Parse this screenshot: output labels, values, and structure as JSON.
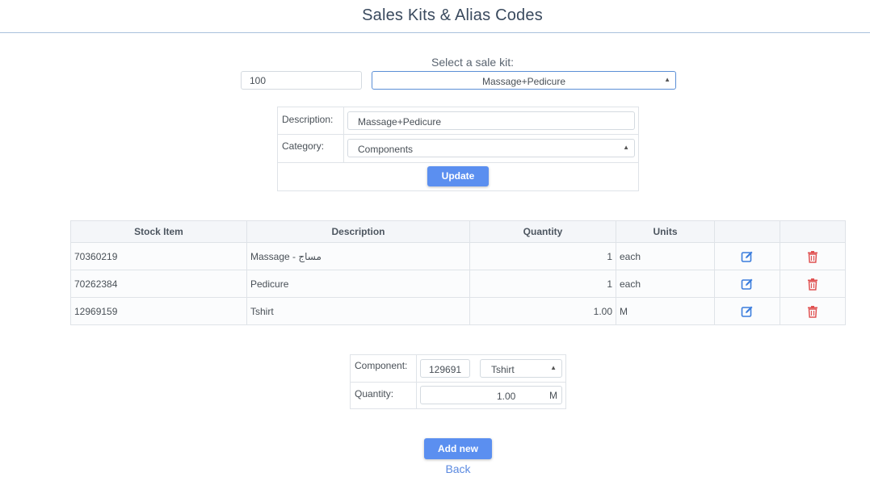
{
  "page": {
    "title": "Sales Kits & Alias Codes"
  },
  "kit_selector": {
    "label": "Select a sale kit:",
    "code_value": "100",
    "selected_kit": "Massage+Pedicure"
  },
  "kit_form": {
    "description_label": "Description:",
    "description_value": "Massage+Pedicure",
    "category_label": "Category:",
    "category_value": "Components",
    "update_label": "Update"
  },
  "components_table": {
    "headers": [
      "Stock Item",
      "Description",
      "Quantity",
      "Units",
      "",
      ""
    ],
    "rows": [
      {
        "stock_item": "70360219",
        "description": "Massage - مساج",
        "quantity": "1",
        "units": "each"
      },
      {
        "stock_item": "70262384",
        "description": "Pedicure",
        "quantity": "1",
        "units": "each"
      },
      {
        "stock_item": "12969159",
        "description": "Tshirt",
        "quantity": "1.00",
        "units": "M"
      }
    ]
  },
  "add_component": {
    "component_label": "Component:",
    "component_code": "129691",
    "component_name": "Tshirt",
    "quantity_label": "Quantity:",
    "quantity_value": "1.00",
    "quantity_unit": "M",
    "add_label": "Add new"
  },
  "nav": {
    "back_label": "Back"
  },
  "colors": {
    "accent": "#5b8ff0",
    "edit_icon": "#3b7ddd",
    "delete_icon": "#e05252",
    "rule": "#a9c2dc"
  }
}
